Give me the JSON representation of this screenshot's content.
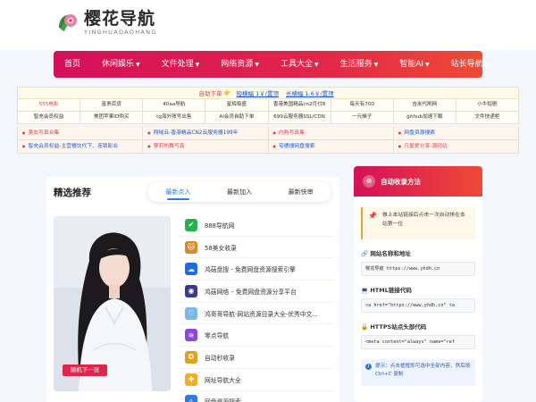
{
  "site": {
    "title": "樱花导航",
    "subtitle": "YINGHUADAOHANG"
  },
  "nav": [
    {
      "label": "首页",
      "has_caret": false
    },
    {
      "label": "休闲娱乐",
      "has_caret": true
    },
    {
      "label": "文件处理",
      "has_caret": true
    },
    {
      "label": "网络资源",
      "has_caret": true
    },
    {
      "label": "工具大全",
      "has_caret": true
    },
    {
      "label": "生活服务",
      "has_caret": true
    },
    {
      "label": "智能AI",
      "has_caret": true
    },
    {
      "label": "站长导航",
      "has_caret": true
    }
  ],
  "promo": {
    "prefix": "自助下单",
    "link1": "短横幅 1￥/置顶",
    "link2": "长横幅 1.6￥/置顶"
  },
  "grid_rows": [
    [
      "555电影",
      "富贵百货",
      "40aa导航",
      "星辉极盛",
      "香港美国精品cn2月付8",
      "每天有700",
      "吉米代刷网",
      "小牛短剧"
    ],
    [
      "智充会员权益",
      "美团苹果ID购买",
      "tg海外账号出售",
      "AI会员自助下单",
      "699云服务器SSL/CDN",
      "一元梯子",
      "github加速下载",
      "文件快递柜"
    ]
  ],
  "grid_red": [
    [
      true,
      false,
      false,
      false,
      false,
      false,
      false,
      false
    ],
    [
      false,
      false,
      false,
      false,
      false,
      false,
      false,
      false
    ]
  ],
  "grid4_rows": [
    [
      {
        "text": "美女写真合集",
        "style": "red"
      },
      {
        "text": "翔域云-香港精品CN2云服务器199年",
        "style": "blue"
      },
      {
        "text": "内购写真集",
        "style": "red"
      },
      {
        "text": "网盘资源搜索",
        "style": "blue"
      }
    ],
    [
      {
        "text": "智充会员权益-主营餐饮代下、连锁影业",
        "style": "blue"
      },
      {
        "text": "萝莉热舞写真",
        "style": "red"
      },
      {
        "text": "夸德搜网盘搜索",
        "style": "blue"
      },
      {
        "text": "凡星爱分享-源码站",
        "style": "red"
      }
    ]
  ],
  "featured": {
    "title": "精选推荐",
    "tabs": [
      "最新点入",
      "最新加入",
      "最新快审"
    ],
    "active_tab": 0,
    "photo_button": "随机下一张",
    "items": [
      {
        "label": "888导航网",
        "icon": "check-shield-icon",
        "color": "#22b24c"
      },
      {
        "label": "58美女收录",
        "icon": "cat-icon",
        "color": "#d88a2a"
      },
      {
        "label": "鸿菇盘搜 - 免费网盘资源搜索引擎",
        "icon": "cloud-icon",
        "color": "#1a6fe0"
      },
      {
        "label": "鸿菇网络 – 免费网盘资源分享平台",
        "icon": "globe-icon",
        "color": "#3a3a8c"
      },
      {
        "label": "鸿哥哥导航-网站资源目录大全-优秀中文...",
        "icon": "heart-icon",
        "color": "#7ab8e8"
      },
      {
        "label": "零点导航",
        "icon": "wave-icon",
        "color": "#8a4ad8"
      },
      {
        "label": "自动秒收录",
        "icon": "seal-icon",
        "color": "#e0a020"
      },
      {
        "label": "网址导航大全",
        "icon": "badge-icon",
        "color": "#f0b020"
      },
      {
        "label": "网盘资源搜索",
        "icon": "search-icon",
        "color": "#2d7be5"
      }
    ]
  },
  "side": {
    "title": "自动收录方法",
    "tip": "做上本站链接后点击一次自动排在本站第一位",
    "sections": [
      {
        "title": "🔗 网站名称和地址",
        "code": "樱花导航 https://www.yhdh.cn"
      },
      {
        "title": "💻 HTML链接代码",
        "code": "<a href=\"https://www.yhdh.cn\" ta"
      },
      {
        "title": "🔒 HTTPS站点头部代码",
        "code": "<meta content=\"always\" name=\"ref"
      }
    ],
    "note": "提示：点击框框即可选中全部内容，然后按 Ctrl+C 复制"
  }
}
